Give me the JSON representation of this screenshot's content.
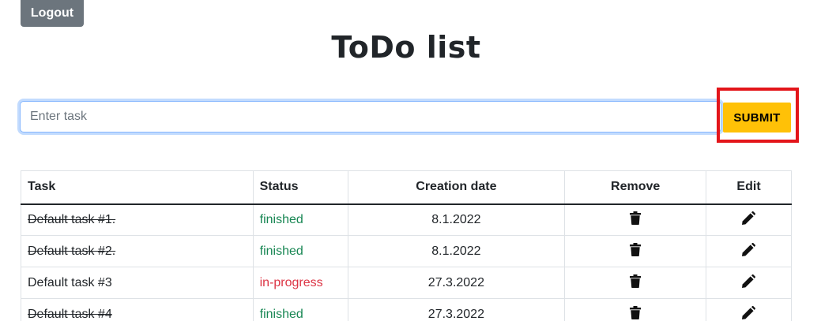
{
  "header": {
    "logout_label": "Logout",
    "title": "ToDo list"
  },
  "form": {
    "input_placeholder": "Enter task",
    "input_value": "",
    "submit_label": "SUBMIT"
  },
  "table": {
    "columns": [
      "Task",
      "Status",
      "Creation date",
      "Remove",
      "Edit"
    ],
    "rows": [
      {
        "task": "Default task #1.",
        "status": "finished",
        "date": "8.1.2022",
        "done": true,
        "remove_icon": "trash-icon",
        "edit_icon": "pencil-icon"
      },
      {
        "task": "Default task #2.",
        "status": "finished",
        "date": "8.1.2022",
        "done": true,
        "remove_icon": "trash-icon",
        "edit_icon": "pencil-icon"
      },
      {
        "task": "Default task #3",
        "status": "in-progress",
        "date": "27.3.2022",
        "done": false,
        "remove_icon": "trash-icon",
        "edit_icon": "pencil-icon"
      },
      {
        "task": "Default task #4",
        "status": "finished",
        "date": "27.3.2022",
        "done": true,
        "remove_icon": "trash-icon",
        "edit_icon": "pencil-icon"
      }
    ]
  },
  "colors": {
    "logout_bg": "#6c757d",
    "submit_bg": "#ffc107",
    "finished": "#198754",
    "in_progress": "#dc3545",
    "highlight": "#e3151a"
  }
}
